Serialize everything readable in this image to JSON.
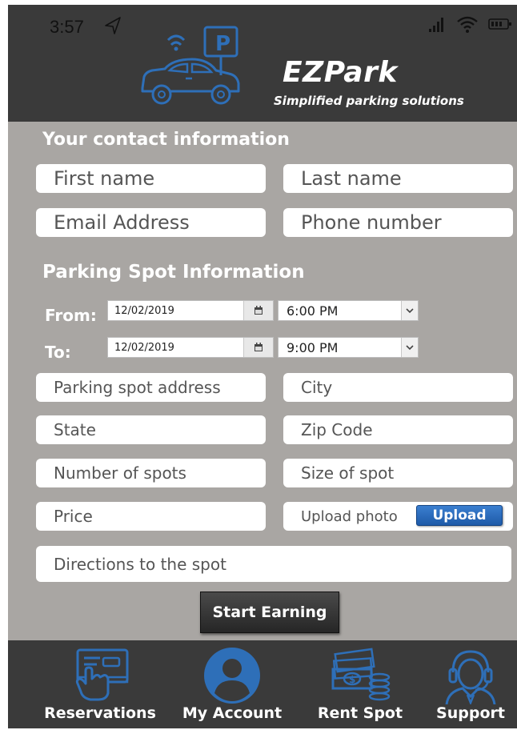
{
  "status_bar": {
    "time": "3:57"
  },
  "brand": {
    "name": "EZPark",
    "tagline": "Simplified parking solutions"
  },
  "contact": {
    "heading": "Your contact information",
    "first_name": "First name",
    "last_name": "Last name",
    "email": "Email Address",
    "phone": "Phone number"
  },
  "spot": {
    "heading": "Parking Spot Information",
    "from_label": "From:",
    "to_label": "To:",
    "from_date": "12/02/2019",
    "from_time": "6:00 PM",
    "to_date": "12/02/2019",
    "to_time": "9:00 PM",
    "address": "Parking spot address",
    "city": "City",
    "state": "State",
    "zip": "Zip Code",
    "num_spots": "Number of spots",
    "size": "Size of spot",
    "price": "Price",
    "upload_label": "Upload photo",
    "upload_button": "Upload",
    "directions": "Directions to the spot"
  },
  "start_button": "Start Earning",
  "nav": {
    "items": [
      {
        "label": "Reservations",
        "icon": "reservations-icon"
      },
      {
        "label": "My Account",
        "icon": "account-icon"
      },
      {
        "label": "Rent Spot",
        "icon": "money-icon"
      },
      {
        "label": "Support",
        "icon": "support-icon"
      }
    ]
  },
  "colors": {
    "accent": "#2e6fb8",
    "header": "#3a3a3a",
    "panel": "#a9a6a3",
    "upload": "#1e5aa8"
  }
}
